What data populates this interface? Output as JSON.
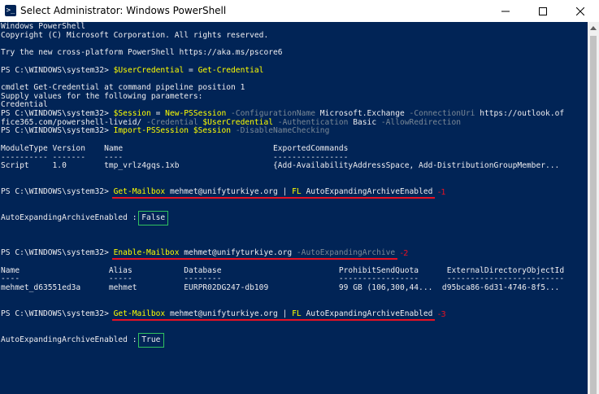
{
  "window": {
    "title": "Select Administrator: Windows PowerShell",
    "icon": "powershell-icon"
  },
  "console": {
    "lines": [
      [
        {
          "t": "Windows PowerShell",
          "c": "w"
        }
      ],
      [
        {
          "t": "Copyright (C) Microsoft Corporation. All rights reserved.",
          "c": "w"
        }
      ],
      [
        {
          "t": "",
          "c": "w"
        }
      ],
      [
        {
          "t": "Try the new cross-platform PowerShell https://aka.ms/pscore6",
          "c": "w"
        }
      ],
      [
        {
          "t": "",
          "c": "w"
        }
      ],
      [
        {
          "t": "PS C:\\WINDOWS\\system32> ",
          "c": "w"
        },
        {
          "t": "$UserCredential",
          "c": "y"
        },
        {
          "t": " = ",
          "c": "w"
        },
        {
          "t": "Get-Credential",
          "c": "y"
        }
      ],
      [
        {
          "t": "",
          "c": "w"
        }
      ],
      [
        {
          "t": "cmdlet Get-Credential at command pipeline position 1",
          "c": "w"
        }
      ],
      [
        {
          "t": "Supply values for the following parameters:",
          "c": "w"
        }
      ],
      [
        {
          "t": "Credential",
          "c": "w"
        }
      ],
      [
        {
          "t": "PS C:\\WINDOWS\\system32> ",
          "c": "w"
        },
        {
          "t": "$Session",
          "c": "y"
        },
        {
          "t": " = ",
          "c": "w"
        },
        {
          "t": "New-PSSession",
          "c": "y"
        },
        {
          "t": " -ConfigurationName ",
          "c": "g"
        },
        {
          "t": "Microsoft.Exchange",
          "c": "w"
        },
        {
          "t": " -ConnectionUri ",
          "c": "g"
        },
        {
          "t": "https://outlook.of",
          "c": "w"
        }
      ],
      [
        {
          "t": "fice365.com/powershell-liveid/",
          "c": "w"
        },
        {
          "t": " -Credential ",
          "c": "g"
        },
        {
          "t": "$UserCredential",
          "c": "y"
        },
        {
          "t": " -Authentication ",
          "c": "g"
        },
        {
          "t": "Basic",
          "c": "w"
        },
        {
          "t": " -AllowRedirection",
          "c": "g"
        }
      ],
      [
        {
          "t": "PS C:\\WINDOWS\\system32> ",
          "c": "w"
        },
        {
          "t": "Import-PSSession",
          "c": "y"
        },
        {
          "t": " ",
          "c": "w"
        },
        {
          "t": "$Session",
          "c": "y"
        },
        {
          "t": " -DisableNameChecking",
          "c": "g"
        }
      ],
      [
        {
          "t": "",
          "c": "w"
        }
      ],
      [
        {
          "t": "ModuleType Version    Name                                ExportedCommands",
          "c": "w"
        }
      ],
      [
        {
          "t": "---------- -------    ----                                ----------------",
          "c": "w"
        }
      ],
      [
        {
          "t": "Script     1.0        tmp_vrlz4gqs.1xb                    {Add-AvailabilityAddressSpace, Add-DistributionGroupMember...",
          "c": "w"
        }
      ],
      [
        {
          "t": "",
          "c": "w"
        }
      ],
      [
        {
          "t": "",
          "c": "w"
        }
      ],
      [
        {
          "t": "PS C:\\WINDOWS\\system32> ",
          "c": "w"
        },
        {
          "t": "Get-Mailbox",
          "c": "y"
        },
        {
          "t": " mehmet@unifyturkiye.org | ",
          "c": "w"
        },
        {
          "t": "FL",
          "c": "y"
        },
        {
          "t": " AutoExpandingArchiveEnabled",
          "c": "w"
        }
      ],
      [
        {
          "t": "",
          "c": "w"
        }
      ],
      [
        {
          "t": "",
          "c": "w"
        }
      ],
      [
        {
          "t": "AutoExpandingArchiveEnabled : False",
          "c": "w"
        }
      ],
      [
        {
          "t": "",
          "c": "w"
        }
      ],
      [
        {
          "t": "",
          "c": "w"
        }
      ],
      [
        {
          "t": "",
          "c": "w"
        }
      ],
      [
        {
          "t": "PS C:\\WINDOWS\\system32> ",
          "c": "w"
        },
        {
          "t": "Enable-Mailbox",
          "c": "y"
        },
        {
          "t": " mehmet@unifyturkiye.org ",
          "c": "w"
        },
        {
          "t": "-AutoExpandingArchive",
          "c": "g"
        }
      ],
      [
        {
          "t": "",
          "c": "w"
        }
      ],
      [
        {
          "t": "Name                   Alias           Database                         ProhibitSendQuota      ExternalDirectoryObjectId",
          "c": "w"
        }
      ],
      [
        {
          "t": "----                   -----           --------                         -----------------      -------------------------",
          "c": "w"
        }
      ],
      [
        {
          "t": "mehmet_d63551ed3a      mehmet          EURPR02DG247-db109               99 GB (106,300,44...  d95bca86-6d31-4746-8f5...",
          "c": "w"
        }
      ],
      [
        {
          "t": "",
          "c": "w"
        }
      ],
      [
        {
          "t": "",
          "c": "w"
        }
      ],
      [
        {
          "t": "PS C:\\WINDOWS\\system32> ",
          "c": "w"
        },
        {
          "t": "Get-Mailbox",
          "c": "y"
        },
        {
          "t": " mehmet@unifyturkiye.org | ",
          "c": "w"
        },
        {
          "t": "FL",
          "c": "y"
        },
        {
          "t": " AutoExpandingArchiveEnabled",
          "c": "w"
        }
      ],
      [
        {
          "t": "",
          "c": "w"
        }
      ],
      [
        {
          "t": "",
          "c": "w"
        }
      ],
      [
        {
          "t": "AutoExpandingArchiveEnabled : True",
          "c": "w"
        }
      ]
    ],
    "annotations": [
      {
        "label": "-1",
        "line": 19,
        "color": "#e81123"
      },
      {
        "label": "-2",
        "line": 26,
        "color": "#e81123"
      },
      {
        "label": "-3",
        "line": 33,
        "color": "#e81123"
      }
    ],
    "highlight_boxes": [
      {
        "line": 22,
        "value": "False",
        "color": "#31c15f"
      },
      {
        "line": 36,
        "value": "True",
        "color": "#31c15f"
      }
    ]
  }
}
